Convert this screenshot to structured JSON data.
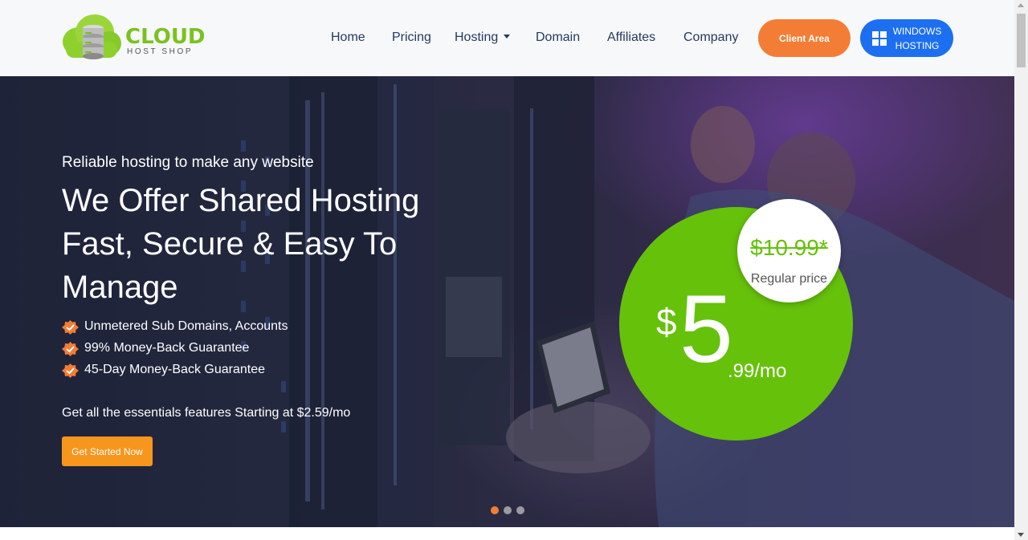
{
  "brand": {
    "name": "CLOUD",
    "subtitle": "HOST SHOP",
    "logo_icon": "cloud-server-icon",
    "color": "#7ac21f"
  },
  "nav": {
    "items": [
      {
        "label": "Home"
      },
      {
        "label": "Pricing"
      },
      {
        "label": "Hosting",
        "has_dropdown": true
      },
      {
        "label": "Domain"
      },
      {
        "label": "Affiliates"
      },
      {
        "label": "Company"
      }
    ],
    "client_area_label": "Client Area",
    "windows_label_line1": "WINDOWS",
    "windows_label_line2": "HOSTING"
  },
  "hero": {
    "tagline": "Reliable hosting to make any website",
    "headline": "We Offer Shared Hosting Fast, Secure & Easy To Manage",
    "features": [
      "Unmetered Sub Domains, Accounts",
      "99% Money-Back Guarantee",
      "45-Day Money-Back Guarantee"
    ],
    "essentials": "Get all the essentials features Starting at $2.59/mo",
    "cta_label": "Get Started Now",
    "price": {
      "currency": "$",
      "whole": "5",
      "fraction": ".99/mo",
      "regular": "$10.99*",
      "regular_label": "Regular price"
    },
    "slides": {
      "count": 3,
      "active": 0
    }
  },
  "colors": {
    "accent_orange": "#f47d35",
    "cta_orange": "#f7961d",
    "windows_blue": "#1d6ff2",
    "price_green": "#66c10b",
    "nav_text": "#243a5e"
  }
}
